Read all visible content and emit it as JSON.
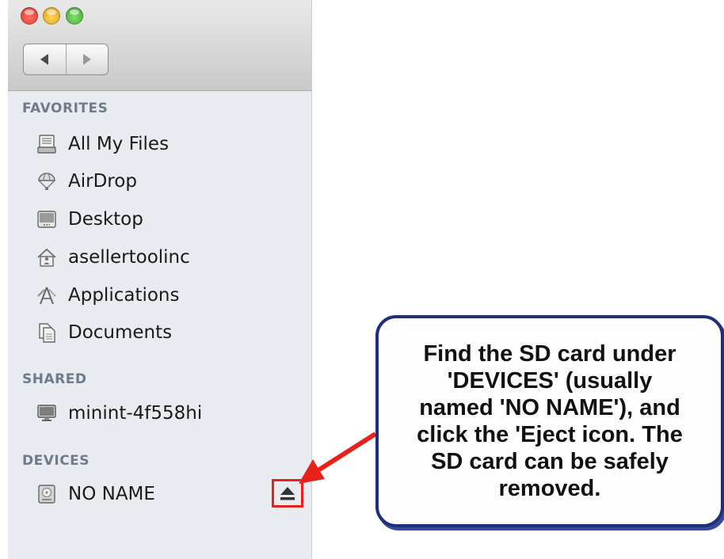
{
  "window": {
    "nav": {
      "back_icon": "back-arrow-icon",
      "forward_icon": "forward-arrow-icon"
    }
  },
  "sidebar": {
    "favorites": {
      "header": "FAVORITES",
      "items": [
        {
          "label": "All My Files",
          "icon": "all-files-icon"
        },
        {
          "label": "AirDrop",
          "icon": "airdrop-icon"
        },
        {
          "label": "Desktop",
          "icon": "desktop-icon"
        },
        {
          "label": "asellertoolinc",
          "icon": "home-icon"
        },
        {
          "label": "Applications",
          "icon": "applications-icon"
        },
        {
          "label": "Documents",
          "icon": "documents-icon"
        }
      ]
    },
    "shared": {
      "header": "SHARED",
      "items": [
        {
          "label": "minint-4f558hi",
          "icon": "computer-icon"
        }
      ]
    },
    "devices": {
      "header": "DEVICES",
      "items": [
        {
          "label": "NO NAME",
          "icon": "disk-icon",
          "action_icon": "eject-icon"
        }
      ]
    }
  },
  "callout": {
    "text": "Find the SD card under\n'DEVICES' (usually\nnamed 'NO NAME'), and\nclick the 'Eject icon. The\nSD card can be safely\nremoved."
  },
  "colors": {
    "callout_border": "#1f2f7a",
    "highlight": "#e8221b",
    "section_header": "#6e7b8b"
  }
}
